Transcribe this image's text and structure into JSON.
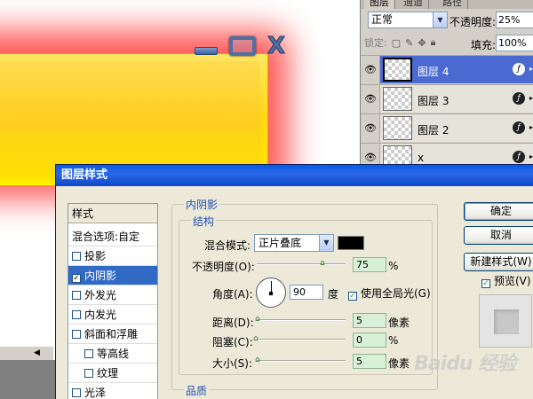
{
  "canvas": {
    "colors": {
      "glow": "#ff3b3b",
      "box": "#ffd21e"
    },
    "controls": {
      "close_glyph": "X"
    }
  },
  "layers_panel": {
    "tabs": [
      "图层",
      "通道",
      "路径"
    ],
    "blend_mode": "正常",
    "opacity_label": "不透明度:",
    "opacity_value": "25%",
    "lock_label": "锁定:",
    "fill_label": "填充:",
    "fill_value": "100%",
    "layers": [
      {
        "name": "图层 4",
        "selected": true
      },
      {
        "name": "图层 3",
        "selected": false
      },
      {
        "name": "图层 2",
        "selected": false
      },
      {
        "name": "x",
        "selected": false
      }
    ]
  },
  "dialog": {
    "title": "图层样式",
    "style_list": {
      "header": "样式",
      "blend_options": "混合选项:自定",
      "items": [
        {
          "label": "投影",
          "checked": false,
          "selected": false,
          "indent": false
        },
        {
          "label": "内阴影",
          "checked": true,
          "selected": true,
          "indent": false
        },
        {
          "label": "外发光",
          "checked": false,
          "selected": false,
          "indent": false
        },
        {
          "label": "内发光",
          "checked": false,
          "selected": false,
          "indent": false
        },
        {
          "label": "斜面和浮雕",
          "checked": false,
          "selected": false,
          "indent": false
        },
        {
          "label": "等高线",
          "checked": false,
          "selected": false,
          "indent": true
        },
        {
          "label": "纹理",
          "checked": false,
          "selected": false,
          "indent": true
        },
        {
          "label": "光泽",
          "checked": false,
          "selected": false,
          "indent": false
        }
      ]
    },
    "inner_shadow_legend": "内阴影",
    "structure_legend": "结构",
    "quality_legend": "品质",
    "blend_mode_label": "混合模式:",
    "blend_mode_value": "正片叠底",
    "shadow_color": "#000000",
    "opacity_label": "不透明度(O):",
    "opacity_value": "75",
    "opacity_unit": "%",
    "opacity_level": 0.75,
    "angle_label": "角度(A):",
    "angle_value": "90",
    "angle_unit": "度",
    "global_light_label": "使用全局光(G)",
    "global_light_checked": true,
    "distance_label": "距离(D):",
    "distance_value": "5",
    "distance_unit": "像素",
    "choke_label": "阻塞(C):",
    "choke_value": "0",
    "choke_unit": "%",
    "size_label": "大小(S):",
    "size_value": "5",
    "size_unit": "像素",
    "buttons": {
      "ok": "确定",
      "cancel": "取消",
      "new_style": "新建样式(W)"
    },
    "preview_label": "预览(V)",
    "preview_checked": true
  },
  "watermark": "Baidu 经验"
}
